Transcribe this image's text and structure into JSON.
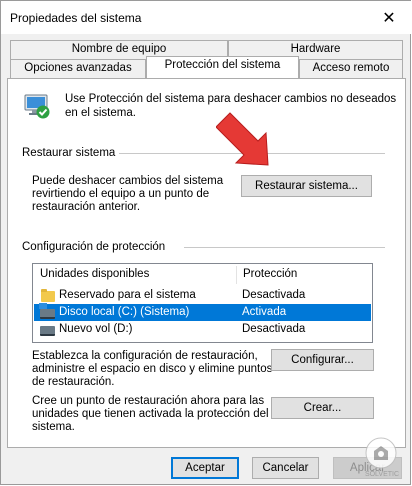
{
  "window": {
    "title": "Propiedades del sistema",
    "close_glyph": "✕"
  },
  "tabs": {
    "row_top": [
      "Nombre de equipo",
      "Hardware"
    ],
    "row_bottom": [
      "Opciones avanzadas",
      "Protección del sistema",
      "Acceso remoto"
    ],
    "active": "Protección del sistema"
  },
  "intro": {
    "line1": "Use Protección del sistema para deshacer cambios no deseados",
    "line2": "en el sistema."
  },
  "restore": {
    "heading": "Restaurar sistema",
    "desc_line1": "Puede deshacer cambios del sistema",
    "desc_line2": "revirtiendo el equipo a un punto de",
    "desc_line3": "restauración anterior.",
    "button": "Restaurar sistema..."
  },
  "protection": {
    "heading": "Configuración de protección",
    "columns": [
      "Unidades disponibles",
      "Protección"
    ],
    "drives": [
      {
        "name": "Reservado para el sistema",
        "status": "Desactivada",
        "icon": "folder-icon"
      },
      {
        "name": "Disco local (C:) (Sistema)",
        "status": "Activada",
        "icon": "system-drive-icon",
        "selected": true
      },
      {
        "name": "Nuevo vol (D:)",
        "status": "Desactivada",
        "icon": "drive-icon"
      }
    ]
  },
  "configure": {
    "line1": "Establezca la configuración de restauración,",
    "line2": "administre el espacio en disco y elimine puntos",
    "line3": "de restauración.",
    "button": "Configurar..."
  },
  "create": {
    "line1": "Cree un punto de restauración ahora para las",
    "line2": "unidades que tienen activada la protección del",
    "line3": "sistema.",
    "button": "Crear..."
  },
  "footer": {
    "ok": "Aceptar",
    "cancel": "Cancelar",
    "apply": "Aplicar"
  },
  "watermark": "SOLVETIC",
  "colors": {
    "selection": "#0078d7",
    "arrow": "#e53935"
  }
}
